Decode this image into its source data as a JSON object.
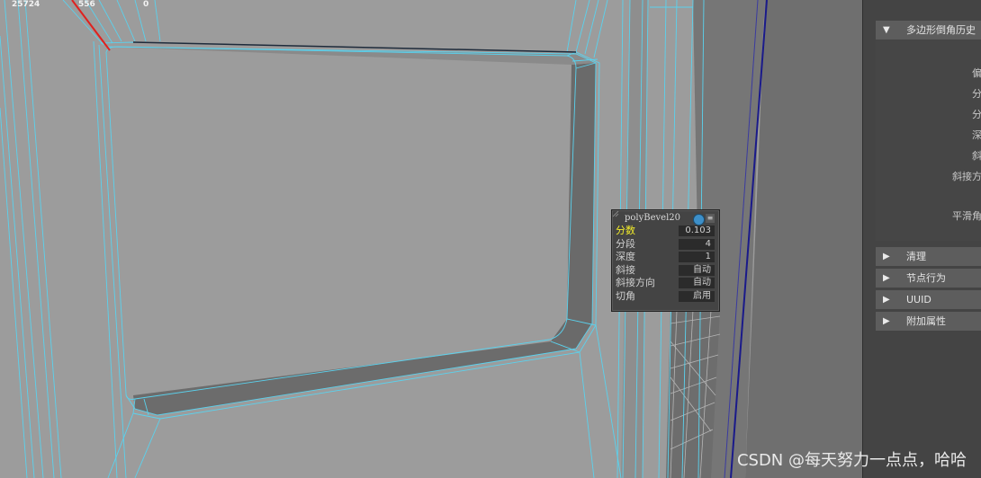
{
  "hud": {
    "stat1": "25724",
    "stat2": "556",
    "stat3": "0"
  },
  "popup": {
    "title": "polyBevel20",
    "rows": [
      {
        "label": "分数",
        "value": "0.103"
      },
      {
        "label": "分段",
        "value": "4"
      },
      {
        "label": "深度",
        "value": "1"
      },
      {
        "label": "斜接",
        "value": "自动"
      },
      {
        "label": "斜接方向",
        "value": "自动"
      },
      {
        "label": "切角",
        "value": "启用"
      }
    ],
    "icons": {
      "pin": "pin-icon",
      "menu": "menu-icon"
    }
  },
  "panel": {
    "section_open": "多边形倒角历史",
    "partial_labels": [
      "偏",
      "分",
      "分",
      "深",
      "斜",
      "斜接方",
      "平滑角"
    ],
    "sections": [
      "清理",
      "节点行为",
      "UUID",
      "附加属性"
    ]
  },
  "watermark": "CSDN @每天努力一点点，哈哈",
  "colors": {
    "viewport_bg": "#9c9c9c",
    "wireframe": "#5ad2ee",
    "selected_edge": "#e0201e",
    "label_highlight": "#f4ee2a"
  }
}
